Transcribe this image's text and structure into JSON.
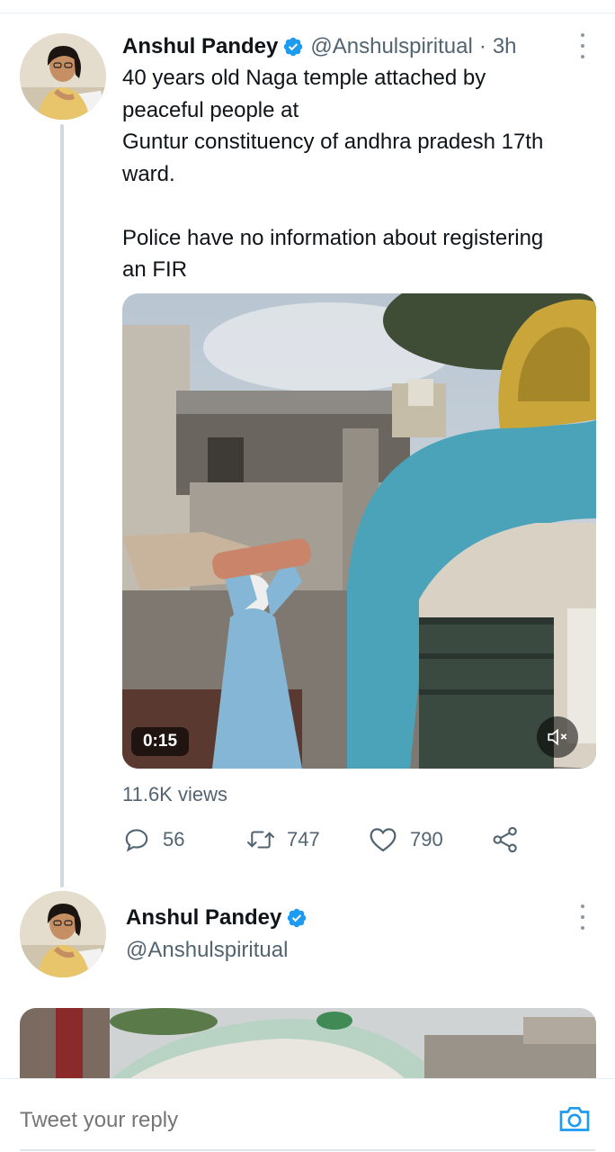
{
  "tweet": {
    "author_name": "Anshul Pandey",
    "handle": "@Anshulspiritual",
    "separator": "·",
    "time": "3h",
    "text_lines": [
      "40 years old Naga temple attached by",
      "peaceful people at",
      "Guntur constituency of andhra pradesh 17th",
      "ward."
    ],
    "text_lines_2": [
      "Police have no information about registering",
      "an FIR"
    ],
    "media": {
      "duration": "0:15",
      "mute_icon": "speaker-muted-icon"
    },
    "views": "11.6K views",
    "actions": {
      "replies": "56",
      "retweets": "747",
      "likes": "790"
    }
  },
  "tweet2": {
    "author_name": "Anshul Pandey",
    "handle": "@Anshulspiritual"
  },
  "reply_bar": {
    "placeholder": "Tweet your reply"
  },
  "colors": {
    "verified_blue": "#1d9bf0",
    "text_primary": "#0f1419",
    "text_secondary": "#536471",
    "accent": "#1d9bf0"
  }
}
